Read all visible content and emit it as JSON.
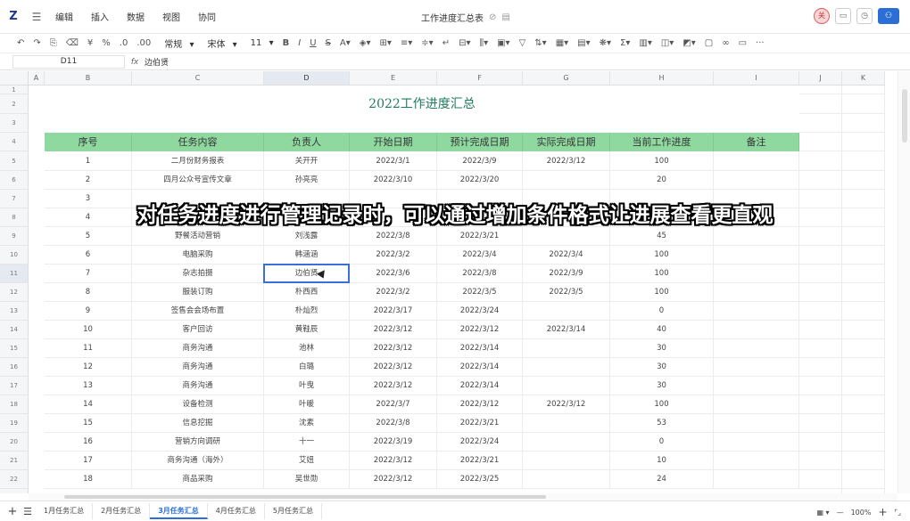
{
  "app": {
    "logo": "Z",
    "title": "工作进度汇总表"
  },
  "menu": [
    "编辑",
    "插入",
    "数据",
    "视图",
    "协同"
  ],
  "user": {
    "avatar_text": "关"
  },
  "toolbar": {
    "format_select": "常规",
    "font_select": "宋体",
    "size_select": "11",
    "bold": "B",
    "italic": "I",
    "underline": "U",
    "strike": "S",
    "percent": "%",
    "currency": "¥",
    "more": "···"
  },
  "formula_bar": {
    "cell_ref": "D11",
    "fx": "fx",
    "value": "边伯贤"
  },
  "columns": [
    "A",
    "B",
    "C",
    "D",
    "E",
    "F",
    "G",
    "H",
    "I",
    "J",
    "K"
  ],
  "active_column": "D",
  "active_row": 11,
  "sheet_title": "2022工作进度汇总",
  "headers": [
    "序号",
    "任务内容",
    "负责人",
    "开始日期",
    "预计完成日期",
    "实际完成日期",
    "当前工作进度",
    "备注"
  ],
  "rows": [
    [
      "1",
      "二月份财务报表",
      "关开开",
      "2022/3/1",
      "2022/3/9",
      "2022/3/12",
      "100",
      ""
    ],
    [
      "2",
      "四月公众号宣传文章",
      "孙亮亮",
      "2022/3/10",
      "2022/3/20",
      "",
      "20",
      ""
    ],
    [
      "3",
      "",
      "",
      "",
      "",
      "",
      "",
      ""
    ],
    [
      "4",
      "",
      "",
      "",
      "",
      "",
      "",
      ""
    ],
    [
      "5",
      "野餐活动营销",
      "刘浅露",
      "2022/3/8",
      "2022/3/21",
      "",
      "45",
      ""
    ],
    [
      "6",
      "电脑采购",
      "韩涵涵",
      "2022/3/2",
      "2022/3/4",
      "2022/3/4",
      "100",
      ""
    ],
    [
      "7",
      "杂志拍摄",
      "边伯贤",
      "2022/3/6",
      "2022/3/8",
      "2022/3/9",
      "100",
      ""
    ],
    [
      "8",
      "服装订购",
      "朴西西",
      "2022/3/2",
      "2022/3/5",
      "2022/3/5",
      "100",
      ""
    ],
    [
      "9",
      "签售会会场布置",
      "朴灿烈",
      "2022/3/17",
      "2022/3/24",
      "",
      "0",
      ""
    ],
    [
      "10",
      "客户回访",
      "黄鞋辰",
      "2022/3/12",
      "2022/3/12",
      "2022/3/14",
      "40",
      ""
    ],
    [
      "11",
      "商务沟通",
      "池林",
      "2022/3/12",
      "2022/3/14",
      "",
      "30",
      ""
    ],
    [
      "12",
      "商务沟通",
      "白璐",
      "2022/3/12",
      "2022/3/14",
      "",
      "30",
      ""
    ],
    [
      "13",
      "商务沟通",
      "叶曳",
      "2022/3/12",
      "2022/3/14",
      "",
      "30",
      ""
    ],
    [
      "14",
      "设备检测",
      "叶暖",
      "2022/3/7",
      "2022/3/12",
      "2022/3/12",
      "100",
      ""
    ],
    [
      "15",
      "信息挖掘",
      "沈素",
      "2022/3/8",
      "2022/3/21",
      "",
      "53",
      ""
    ],
    [
      "16",
      "营销方向调研",
      "十一",
      "2022/3/19",
      "2022/3/24",
      "",
      "0",
      ""
    ],
    [
      "17",
      "商务沟通（海外）",
      "艾妞",
      "2022/3/12",
      "2022/3/21",
      "",
      "10",
      ""
    ],
    [
      "18",
      "商品采购",
      "吴世勋",
      "2022/3/12",
      "2022/3/25",
      "",
      "24",
      ""
    ]
  ],
  "subtitle": "对任务进度进行管理记录时，可以通过增加条件格式让进展查看更直观",
  "sheets": [
    "1月任务汇总",
    "2月任务汇总",
    "3月任务汇总",
    "4月任务汇总",
    "5月任务汇总"
  ],
  "active_sheet": "3月任务汇总",
  "zoom": "100%",
  "colors": {
    "header_fill": "#8fd9a0",
    "title_text": "#1f7a5e",
    "selection": "#3a6fd8",
    "accent": "#2b6fd6"
  }
}
